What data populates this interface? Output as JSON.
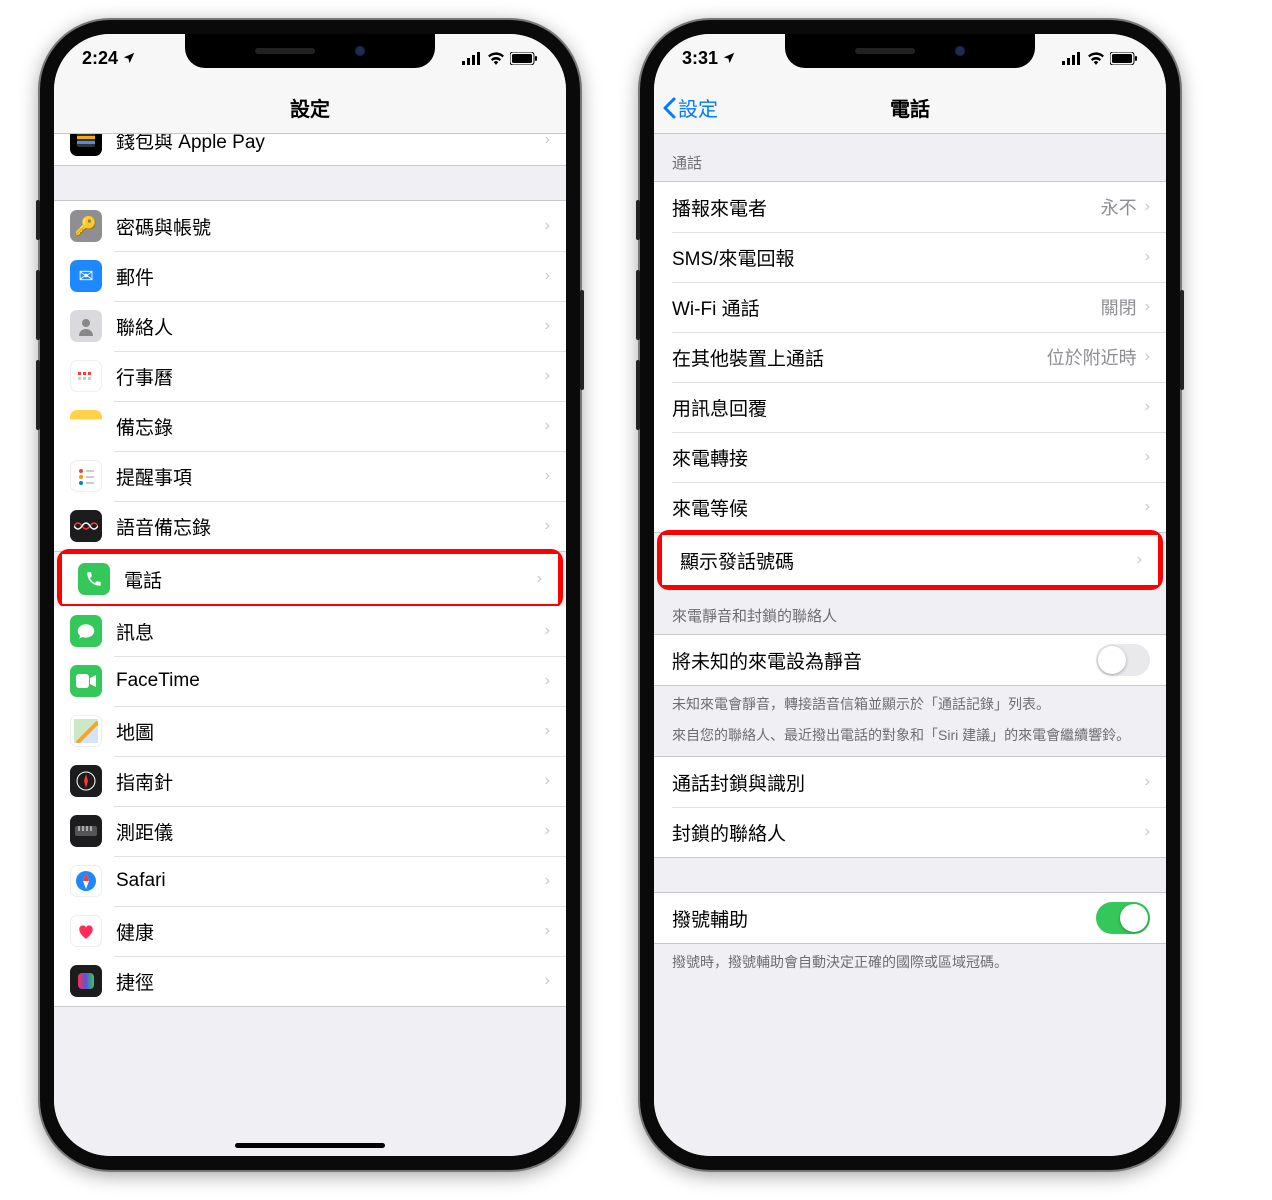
{
  "left": {
    "status_time": "2:24",
    "nav_title": "設定",
    "rows": {
      "wallet": "錢包與 Apple Pay",
      "passwords": "密碼與帳號",
      "mail": "郵件",
      "contacts": "聯絡人",
      "calendar": "行事曆",
      "notes": "備忘錄",
      "reminders": "提醒事項",
      "voicememos": "語音備忘錄",
      "phone": "電話",
      "messages": "訊息",
      "facetime": "FaceTime",
      "maps": "地圖",
      "compass": "指南針",
      "measure": "測距儀",
      "safari": "Safari",
      "health": "健康",
      "shortcuts": "捷徑"
    }
  },
  "right": {
    "status_time": "3:31",
    "nav_back": "設定",
    "nav_title": "電話",
    "section1_hdr": "通話",
    "rows": {
      "announce": {
        "label": "播報來電者",
        "detail": "永不"
      },
      "sms": {
        "label": "SMS/來電回報"
      },
      "wifi": {
        "label": "Wi-Fi 通話",
        "detail": "關閉"
      },
      "other": {
        "label": "在其他裝置上通話",
        "detail": "位於附近時"
      },
      "respond": {
        "label": "用訊息回覆"
      },
      "fwd": {
        "label": "來電轉接"
      },
      "wait": {
        "label": "來電等候"
      },
      "callerid": {
        "label": "顯示發話號碼"
      }
    },
    "section2_hdr": "來電靜音和封鎖的聯絡人",
    "silence": "將未知的來電設為靜音",
    "ftr1": "未知來電會靜音，轉接語音信箱並顯示於「通話記錄」列表。",
    "ftr2": "來自您的聯絡人、最近撥出電話的對象和「Siri 建議」的來電會繼續響鈴。",
    "block_id": "通話封鎖與識別",
    "blocked": "封鎖的聯絡人",
    "dial": "撥號輔助",
    "dial_ftr": "撥號時，撥號輔助會自動決定正確的國際或區域冠碼。"
  }
}
